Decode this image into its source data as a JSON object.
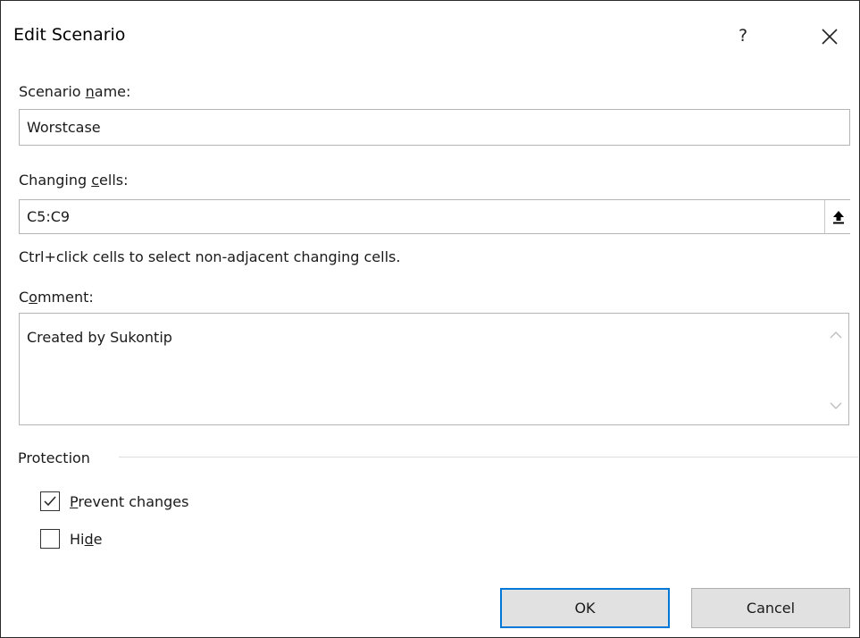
{
  "dialog": {
    "title": "Edit Scenario",
    "help_label": "?",
    "close_icon": "close-icon"
  },
  "scenario_name": {
    "label_pre": "Scenario ",
    "label_accel": "n",
    "label_post": "ame:",
    "value": "Worstcase"
  },
  "changing_cells": {
    "label_pre": "Changing ",
    "label_accel": "c",
    "label_post": "ells:",
    "value": "C5:C9",
    "refedit_icon": "collapse-dialog-icon",
    "hint": "Ctrl+click cells to select non-adjacent changing cells."
  },
  "comment": {
    "label_pre": "C",
    "label_accel": "o",
    "label_post": "mment:",
    "value": "Created by Sukontip",
    "scroll_up_icon": "chevron-up-icon",
    "scroll_down_icon": "chevron-down-icon"
  },
  "protection": {
    "group_label": "Protection",
    "prevent_changes": {
      "label_pre": "",
      "label_accel": "P",
      "label_post": "revent changes",
      "checked": true
    },
    "hide": {
      "label_pre": "Hi",
      "label_accel": "d",
      "label_post": "e",
      "checked": false
    }
  },
  "buttons": {
    "ok": "OK",
    "cancel": "Cancel"
  },
  "colors": {
    "default_button_border": "#0078d7",
    "button_face": "#e1e1e1",
    "field_border": "#b5b5b5"
  }
}
